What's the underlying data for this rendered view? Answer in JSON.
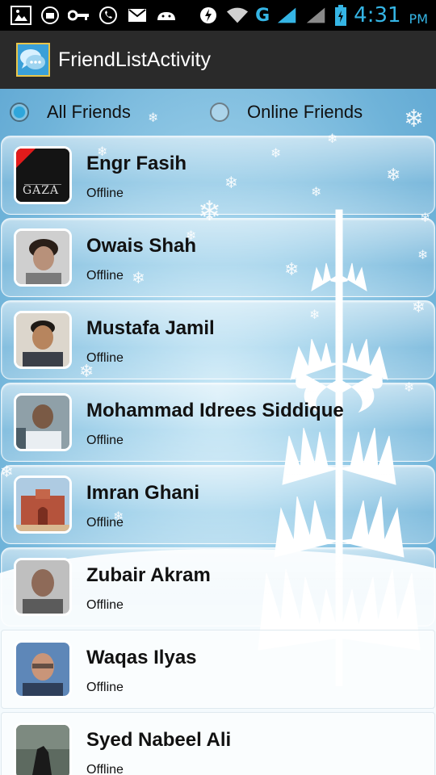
{
  "status_bar": {
    "time": "4:31",
    "ampm": "PM",
    "network": "G",
    "left_icons": [
      "photo-notification-icon",
      "secure-icon",
      "key-icon",
      "whatsapp-icon",
      "gmail-icon",
      "android-icon"
    ],
    "right_icons": [
      "flash-icon",
      "wifi-icon",
      "signal-icon",
      "battery-icon"
    ],
    "accent": "#35b5e5"
  },
  "action_bar": {
    "title": "FriendListActivity",
    "icon": "chat-bubbles-icon"
  },
  "filter": {
    "options": [
      {
        "label": "All Friends",
        "checked": true
      },
      {
        "label": "Online Friends",
        "checked": false
      }
    ]
  },
  "friends": [
    {
      "name": "Engr Fasih",
      "status": "Offline",
      "avatar_text": "GAZA"
    },
    {
      "name": "Owais Shah",
      "status": "Offline"
    },
    {
      "name": "Mustafa Jamil",
      "status": "Offline"
    },
    {
      "name": "Mohammad Idrees Siddique",
      "status": "Offline"
    },
    {
      "name": "Imran Ghani",
      "status": "Offline"
    },
    {
      "name": "Zubair Akram",
      "status": "Offline"
    },
    {
      "name": "Waqas Ilyas",
      "status": "Offline"
    },
    {
      "name": "Syed Nabeel Ali",
      "status": "Offline"
    }
  ]
}
